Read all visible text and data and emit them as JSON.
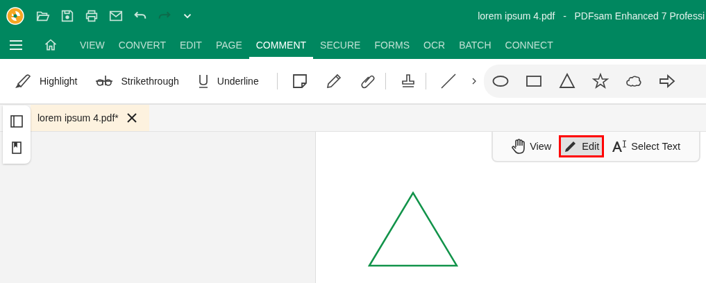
{
  "window": {
    "title": "lorem ipsum 4.pdf   -   PDFsam Enhanced 7 Professi"
  },
  "menu": [
    {
      "label": "VIEW",
      "selected": false
    },
    {
      "label": "CONVERT",
      "selected": false
    },
    {
      "label": "EDIT",
      "selected": false
    },
    {
      "label": "PAGE",
      "selected": false
    },
    {
      "label": "COMMENT",
      "selected": true
    },
    {
      "label": "SECURE",
      "selected": false
    },
    {
      "label": "FORMS",
      "selected": false
    },
    {
      "label": "OCR",
      "selected": false
    },
    {
      "label": "BATCH",
      "selected": false
    },
    {
      "label": "CONNECT",
      "selected": false
    }
  ],
  "toolbar": {
    "tools": [
      {
        "label": "Highlight"
      },
      {
        "label": "Strikethrough"
      },
      {
        "label": "Underline"
      }
    ]
  },
  "tabs": [
    {
      "label": "lorem ipsum 4.pdf*",
      "selected": true
    }
  ],
  "modes": [
    {
      "label": "View",
      "selected": false,
      "highlighted": false
    },
    {
      "label": "Edit",
      "selected": true,
      "highlighted": true
    },
    {
      "label": "Select Text",
      "selected": false,
      "highlighted": false
    }
  ],
  "page": {
    "shapes": [
      {
        "kind": "triangle"
      }
    ]
  }
}
